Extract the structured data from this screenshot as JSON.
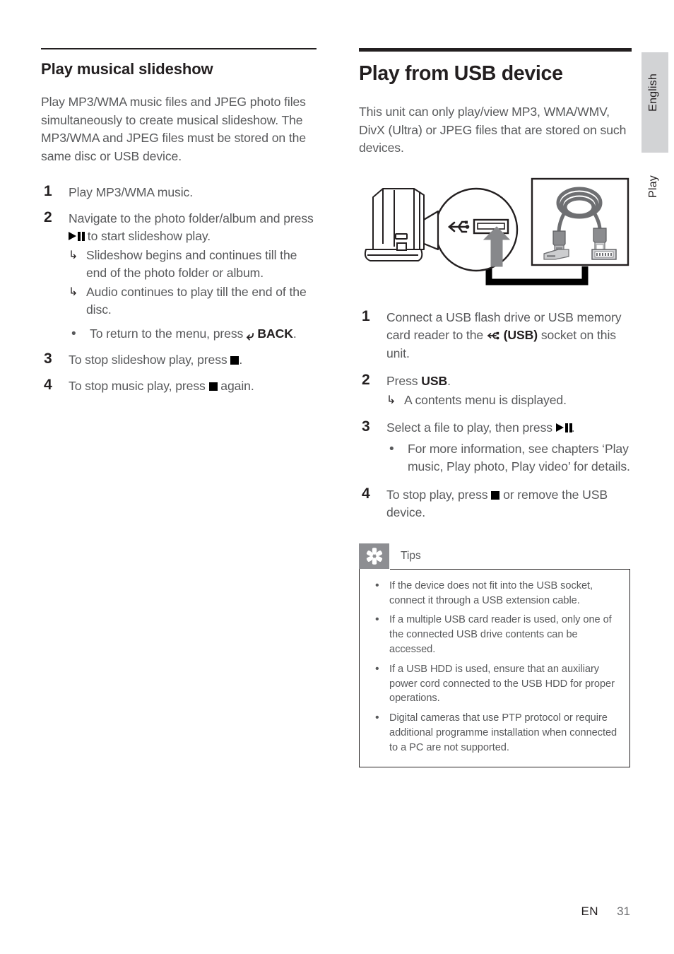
{
  "page": {
    "footer_locale": "EN",
    "footer_page_number": "31",
    "side_tab_language": "English",
    "side_tab_section": "Play",
    "side_tab_color": "#d2d3d5",
    "text_color": "#58595b",
    "heading_color": "#231f20"
  },
  "left_column": {
    "heading": "Play musical slideshow",
    "intro": "Play MP3/WMA music files and JPEG photo files simultaneously to create musical slideshow. The MP3/WMA and JPEG files must be stored on the same disc or USB device.",
    "steps": [
      {
        "num": "1",
        "text_before": "Play MP3/WMA music.",
        "text_after": "",
        "glyph": "",
        "subs": []
      },
      {
        "num": "2",
        "text_before": "Navigate to the photo folder/album and press ",
        "glyph": "play-pause-icon",
        "text_after": " to start slideshow play.",
        "subs": [
          {
            "kind": "arrow",
            "text": "Slideshow begins and continues till the end of the photo folder or album."
          },
          {
            "kind": "arrow",
            "text": "Audio continues to play till the end of the disc."
          },
          {
            "kind": "bullet",
            "text_before": "To return to the menu, press ",
            "glyph": "back-arrow-icon",
            "bold_text": "BACK",
            "text_after": "."
          }
        ]
      },
      {
        "num": "3",
        "text_before": "To stop slideshow play, press ",
        "glyph": "stop-icon",
        "text_after": ".",
        "subs": []
      },
      {
        "num": "4",
        "text_before": "To stop music play, press ",
        "glyph": "stop-icon",
        "text_after": " again.",
        "subs": []
      }
    ]
  },
  "right_column": {
    "heading": "Play from USB device",
    "intro": "This unit can only play/view MP3, WMA/WMV, DivX (Ultra) or JPEG files that are stored on such devices.",
    "figure": {
      "name": "usb-connection-diagram",
      "caption": "",
      "parts": [
        "side view of player with USB socket",
        "magnified callout circle showing USB symbol and socket",
        "grey arrow pointing up into socket",
        "photo of USB extension cable with type-A plug and type-A receptacle"
      ]
    },
    "steps": [
      {
        "num": "1",
        "text_before": "Connect a USB flash drive or USB memory card reader to the ",
        "glyph": "usb-icon",
        "bold_text": " (USB)",
        "text_after": " socket on this unit.",
        "subs": []
      },
      {
        "num": "2",
        "text_before": "Press ",
        "bold_text": "USB",
        "text_after": ".",
        "glyph": "",
        "subs": [
          {
            "kind": "arrow",
            "text": "A contents menu is displayed."
          }
        ]
      },
      {
        "num": "3",
        "text_before": "Select a file to play, then press ",
        "glyph": "play-pause-icon",
        "text_after": ".",
        "subs": [
          {
            "kind": "bullet",
            "text": "For more information, see chapters ‘Play music, Play photo, Play video’ for details."
          }
        ]
      },
      {
        "num": "4",
        "text_before": "To stop play, press ",
        "glyph": "stop-icon",
        "text_after": " or remove the USB device.",
        "subs": []
      }
    ],
    "tips": {
      "title": "Tips",
      "icon": "asterisk-tip-icon",
      "items": [
        "If the device does not fit into the USB socket, connect it through a USB extension cable.",
        "If a multiple USB card reader is used, only one of the connected USB drive contents can be accessed.",
        "If a USB HDD is used, ensure that an auxiliary power cord connected to the USB HDD for proper operations.",
        "Digital cameras that use PTP protocol or require additional programme installation when connected to a PC are not supported."
      ]
    }
  }
}
